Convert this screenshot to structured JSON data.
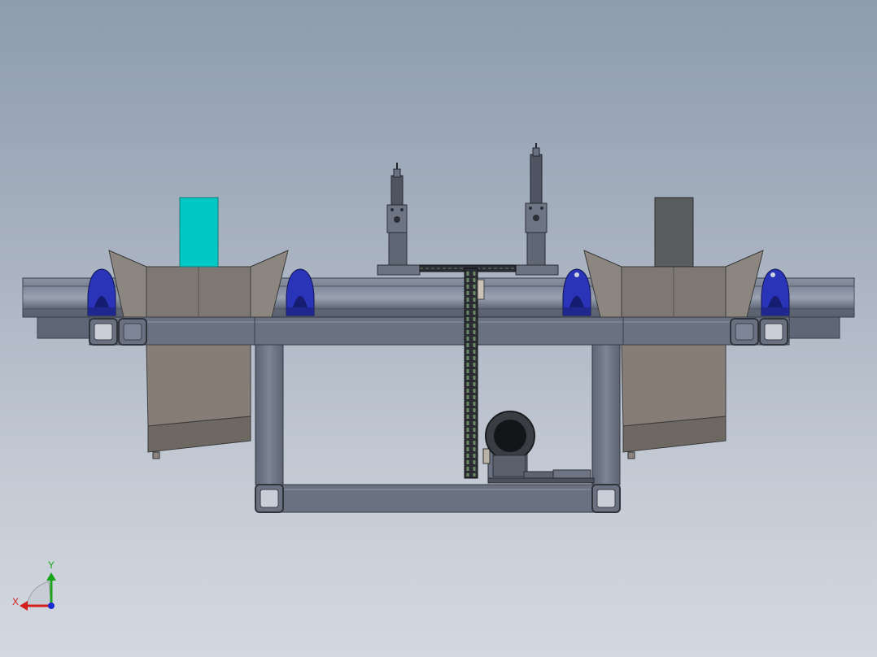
{
  "viewport": {
    "background_top": "#8e9cae",
    "background_bottom": "#d3d8e0"
  },
  "model": {
    "frame_color": "#6d7484",
    "bearing_color": "#2a34b8",
    "hopper_color": "#7d7873",
    "cyan_block_color": "#00c8c4",
    "gray_block_color": "#5a5c60"
  },
  "triad": {
    "x_label": "X",
    "y_label": "Y",
    "x_color": "#d41e1e",
    "y_color": "#1aa31a",
    "z_color": "#1a2ccf"
  }
}
